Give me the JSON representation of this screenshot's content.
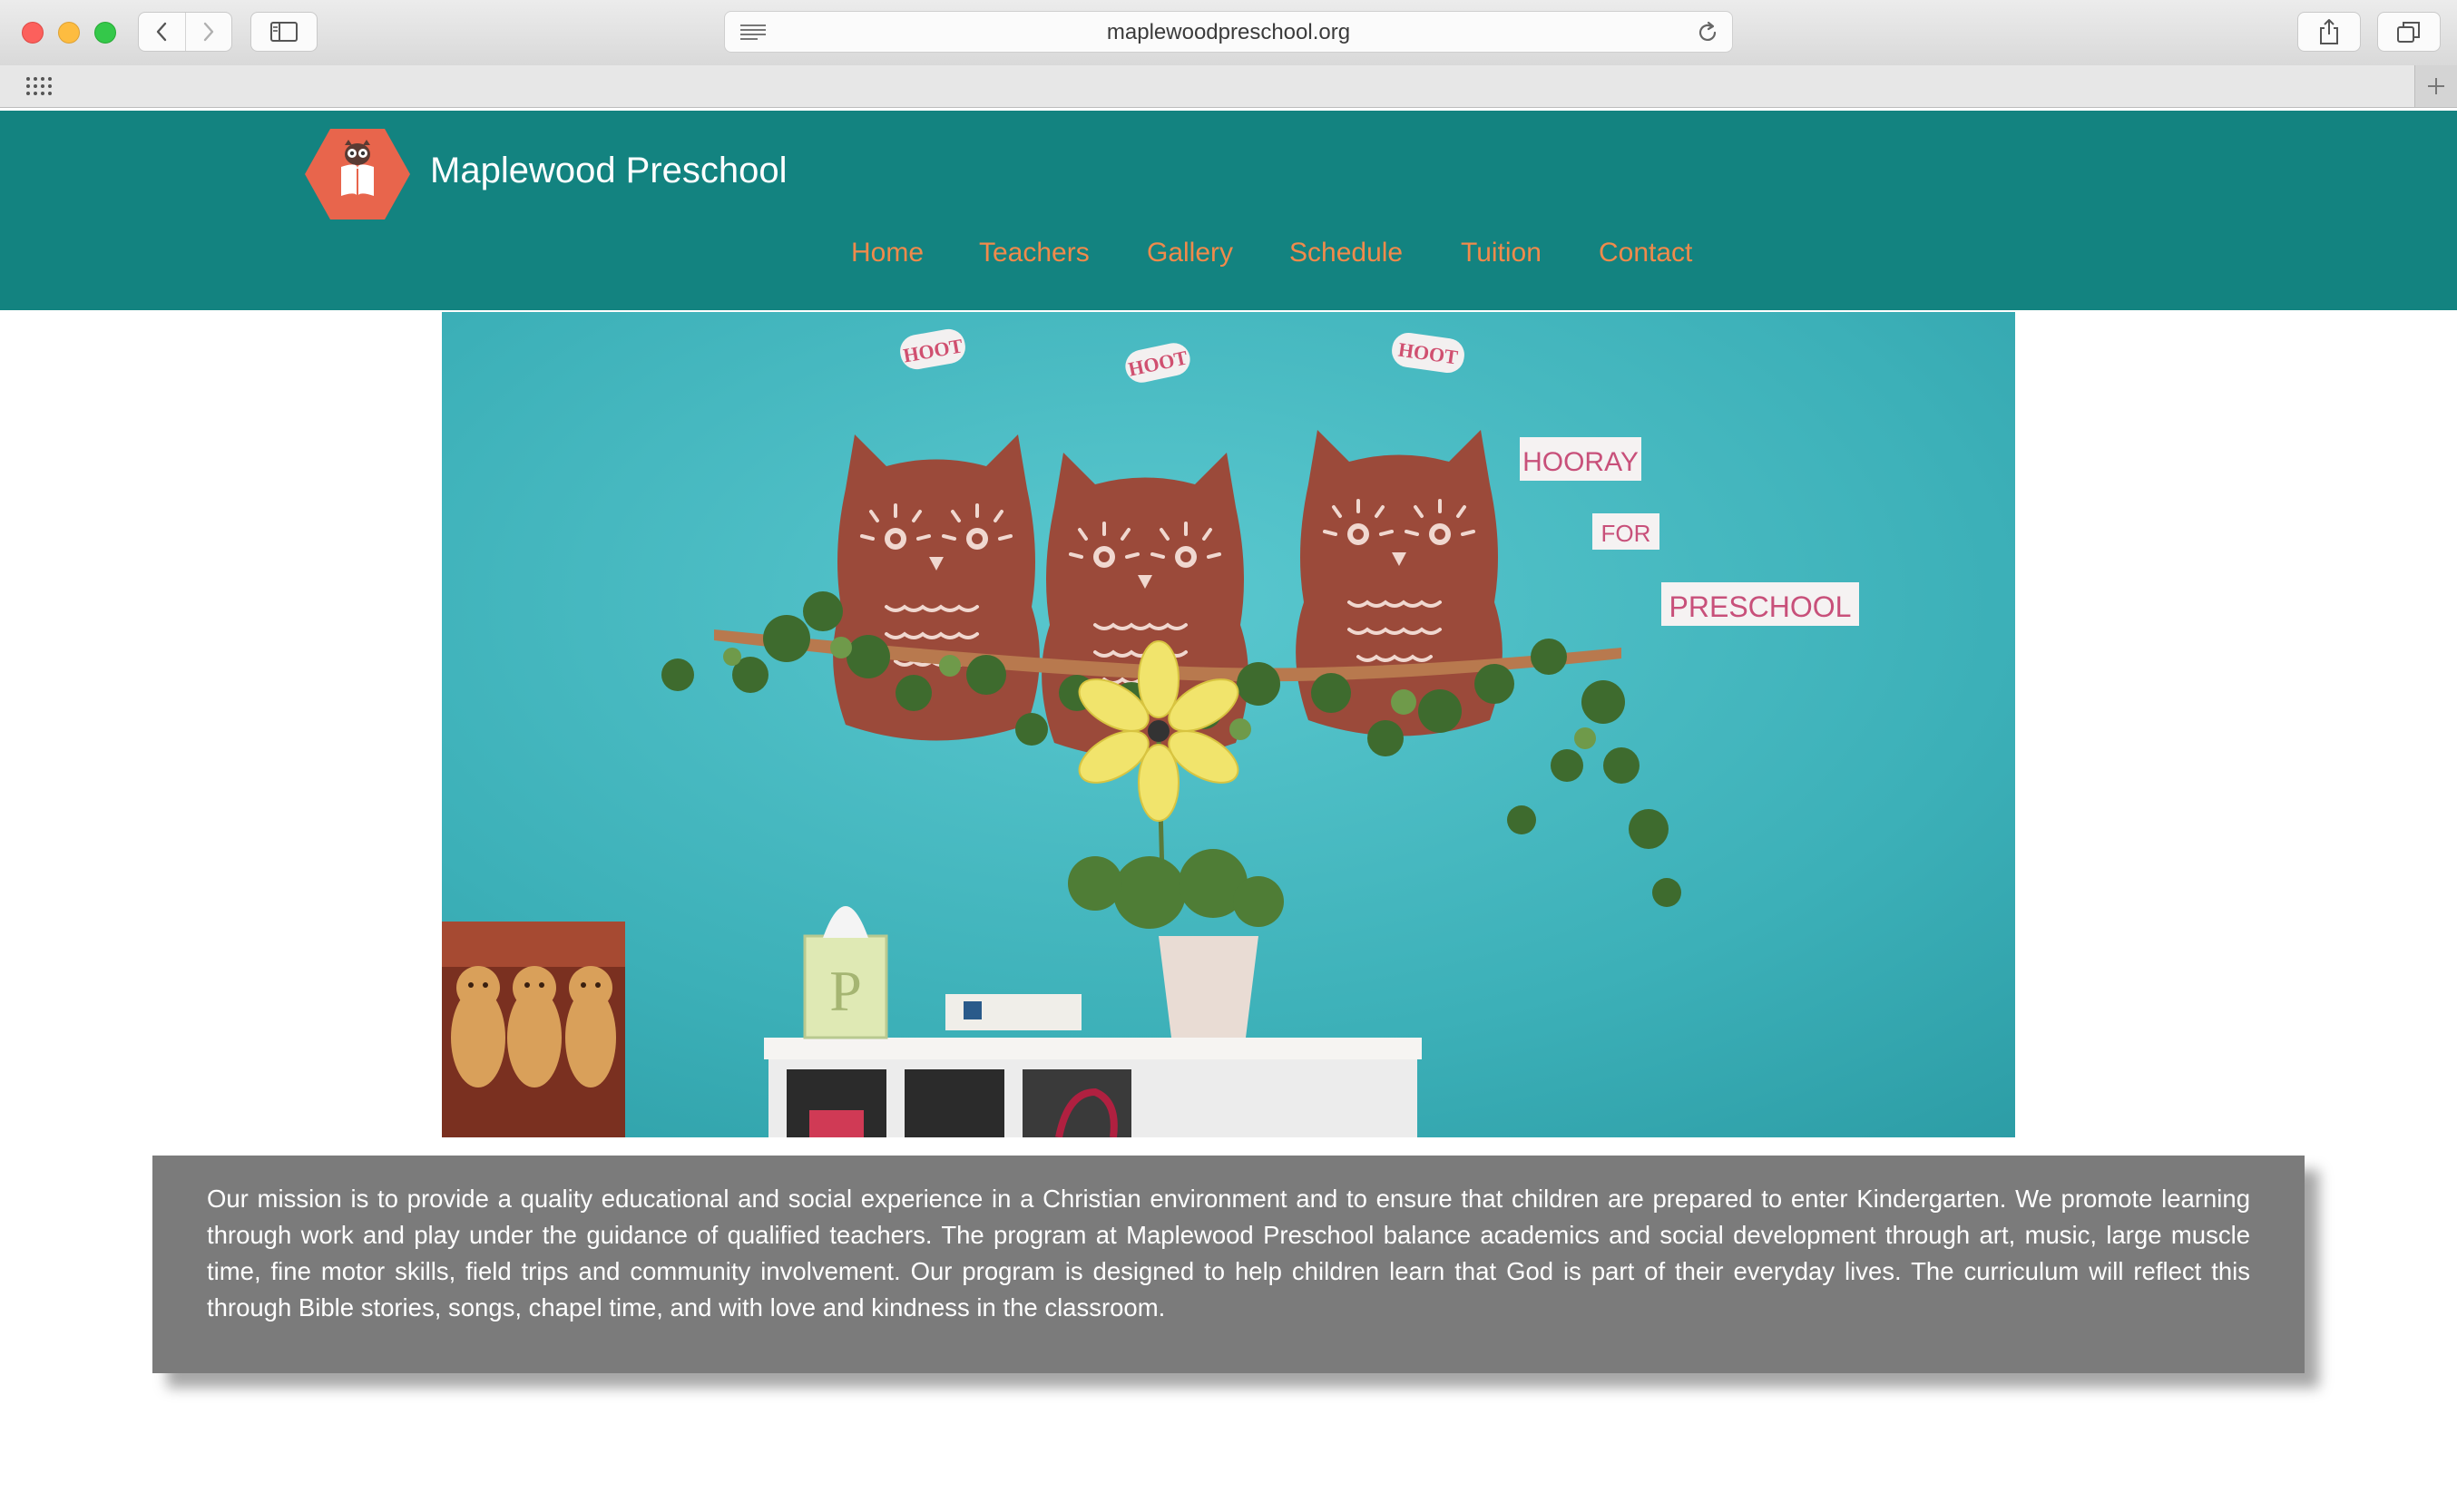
{
  "browser": {
    "url": "maplewoodpreschool.org",
    "icons": {
      "back": "chevron-left-icon",
      "forward": "chevron-right-icon",
      "sidebar": "sidebar-icon",
      "reader": "reader-icon",
      "reload": "reload-icon",
      "share": "share-icon",
      "tabs": "tabs-icon",
      "favorites": "grid-icon",
      "new_tab": "plus-icon"
    }
  },
  "site": {
    "title": "Maplewood Preschool",
    "colors": {
      "header": "#138380",
      "nav_link": "#f08a4b",
      "logo": "#e8654c",
      "mission_bg": "#7b7b7b"
    },
    "nav": {
      "home": "Home",
      "teachers": "Teachers",
      "gallery": "Gallery",
      "schedule": "Schedule",
      "tuition": "Tuition",
      "contact": "Contact"
    }
  },
  "hero": {
    "bubbles": [
      "HOOT",
      "HOOT",
      "HOOT"
    ],
    "sign": [
      "HOORAY",
      "FOR",
      "PRESCHOOL"
    ],
    "block_letter": "P"
  },
  "mission": {
    "text": "Our mission is to provide a quality educational and social experience in a Christian environment and to ensure that children are prepared to enter Kindergarten. We promote learning through work and play under the guidance of qualified teachers. The program at Maplewood Preschool balance academics and social development through art, music, large muscle time, fine motor skills, field trips and community involvement. Our program is designed to help children learn that God is part of their everyday lives. The curriculum will reflect this through Bible stories, songs, chapel time, and with love and kindness in the classroom."
  }
}
